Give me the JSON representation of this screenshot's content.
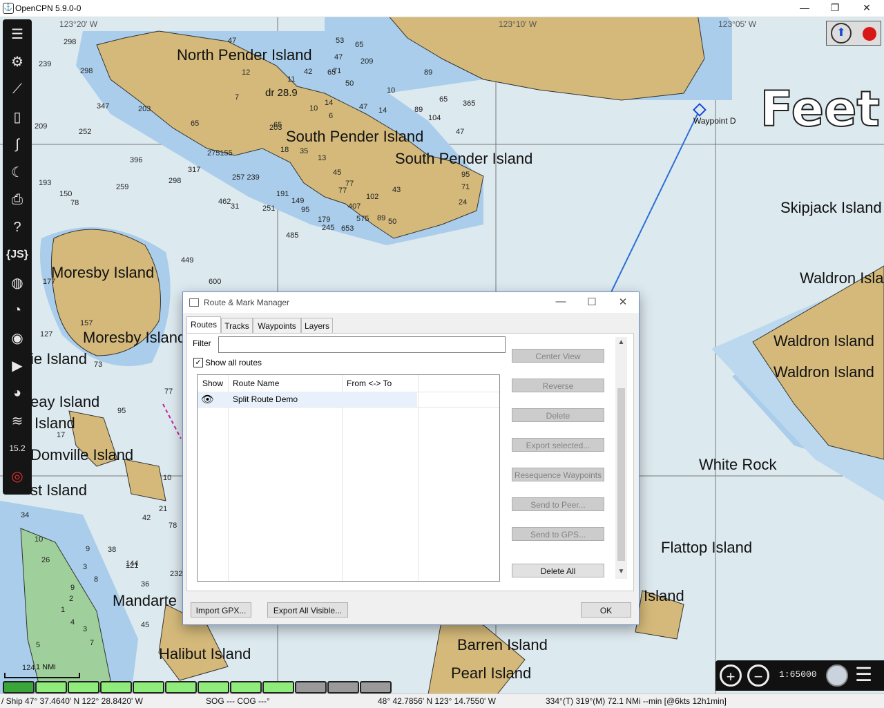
{
  "window": {
    "title": "OpenCPN 5.9.0-0",
    "minimize": "—",
    "maximize": "❐",
    "close": "✕"
  },
  "chart": {
    "units_overlay": "Feet",
    "labels": [
      {
        "id": "north-pender",
        "text": "North Pender Island"
      },
      {
        "id": "south-pender-1",
        "text": "South Pender Island"
      },
      {
        "id": "south-pender-2",
        "text": "South Pender Island"
      },
      {
        "id": "moresby-1",
        "text": "Moresby Island"
      },
      {
        "id": "moresby-2",
        "text": "Moresby Island"
      },
      {
        "id": "skipjack",
        "text": "Skipjack Island"
      },
      {
        "id": "waldron-top",
        "text": "Waldron Isla"
      },
      {
        "id": "waldron-1",
        "text": "Waldron Island"
      },
      {
        "id": "waldron-2",
        "text": "Waldron Island"
      },
      {
        "id": "white-rock",
        "text": "White Rock"
      },
      {
        "id": "flattop",
        "text": "Flattop Island"
      },
      {
        "id": "island-fragment",
        "text": "Island"
      },
      {
        "id": "barren",
        "text": "Barren Island"
      },
      {
        "id": "pearl",
        "text": "Pearl Island"
      },
      {
        "id": "halibut",
        "text": "Halibut Island"
      },
      {
        "id": "mandarte",
        "text": "Mandarte"
      },
      {
        "id": "domville",
        "text": "Domville Island"
      },
      {
        "id": "ie-island",
        "text": "ie Island"
      },
      {
        "id": "eay-island",
        "text": "eay Island"
      },
      {
        "id": "island-left",
        "text": "Island"
      },
      {
        "id": "st-island",
        "text": "st Island"
      },
      {
        "id": "waypoint-d",
        "text": "Waypoint D"
      },
      {
        "id": "dr",
        "text": "dr 28.9"
      }
    ],
    "lon_labels": [
      "123°20' W",
      "123°10' W",
      "123°05' W"
    ],
    "depths": [
      "298",
      "239",
      "298",
      "347",
      "203",
      "65",
      "252",
      "209",
      "396",
      "317",
      "275155",
      "257 239",
      "298",
      "193",
      "150",
      "259",
      "78",
      "462",
      "31",
      "251",
      "191",
      "149",
      "95",
      "179",
      "245",
      "653",
      "407",
      "575",
      "89",
      "50",
      "485",
      "449",
      "600",
      "177",
      "157",
      "127",
      "73",
      "95",
      "77",
      "17",
      "66",
      "34",
      "38",
      "121",
      "144",
      "232",
      "36",
      "45",
      "5",
      "124",
      "78",
      "21",
      "47",
      "53",
      "65",
      "209",
      "47",
      "65",
      "12",
      "11",
      "42",
      "71",
      "7",
      "14",
      "10",
      "6",
      "47",
      "14",
      "10",
      "65",
      "203",
      "18",
      "35",
      "13",
      "45",
      "77",
      "77",
      "102",
      "43",
      "95",
      "71",
      "24",
      "47",
      "89",
      "65",
      "365",
      "104",
      "89",
      "50",
      "10",
      "42",
      "9",
      "3",
      "8",
      "9",
      "2",
      "1",
      "4",
      "3",
      "7",
      "10",
      "26"
    ],
    "dock_value": "15.2"
  },
  "toolbar": [
    {
      "id": "menu",
      "icon": "hamburger-icon"
    },
    {
      "id": "settings",
      "icon": "gear-icon"
    },
    {
      "id": "route",
      "icon": "route-icon"
    },
    {
      "id": "route-manager",
      "icon": "document-icon"
    },
    {
      "id": "track",
      "icon": "track-icon"
    },
    {
      "id": "night-mode",
      "icon": "moon-star-icon"
    },
    {
      "id": "print",
      "icon": "printer-icon"
    },
    {
      "id": "help",
      "icon": "help-icon"
    },
    {
      "id": "js",
      "icon": "js-icon",
      "label": "{JS}"
    },
    {
      "id": "globe",
      "icon": "globe-search-icon"
    },
    {
      "id": "chart-download",
      "icon": "chart-icon"
    },
    {
      "id": "record",
      "icon": "record-icon"
    },
    {
      "id": "play",
      "icon": "play-icon"
    },
    {
      "id": "dashboard",
      "icon": "gauge-icon"
    },
    {
      "id": "tide",
      "icon": "tide-icon"
    },
    {
      "id": "wind",
      "icon": "wind-icon",
      "label": "15.2"
    },
    {
      "id": "mob",
      "icon": "lifebuoy-icon"
    }
  ],
  "scale_bar": {
    "label": "1 NMi"
  },
  "zoom": {
    "in": "+",
    "out": "−",
    "scale": "1:65000"
  },
  "statusbar": {
    "ship": "/ Ship 47° 37.4640' N   122° 28.8420' W",
    "sog": "SOG --- COG ---°",
    "cursor": "48° 42.7856' N   123° 14.7550' W",
    "bearing": "334°(T)  319°(M)  72.1 NMi --min [@6kts 12h1min]"
  },
  "dialog": {
    "title": "Route & Mark Manager",
    "min": "—",
    "max": "☐",
    "close": "✕",
    "tabs": [
      "Routes",
      "Tracks",
      "Waypoints",
      "Layers"
    ],
    "active_tab": "Routes",
    "filter_label": "Filter",
    "filter_value": "",
    "show_all_label": "Show all routes",
    "show_all_checked": true,
    "columns": [
      "Show",
      "Route Name",
      "From <-> To"
    ],
    "routes": [
      {
        "show": "visible",
        "name": "Split Route Demo",
        "from_to": ""
      }
    ],
    "side_buttons": [
      {
        "label": "Center View",
        "enabled": false
      },
      {
        "label": "Reverse",
        "enabled": false
      },
      {
        "label": "Delete",
        "enabled": false
      },
      {
        "label": "Export selected...",
        "enabled": false
      },
      {
        "label": "Resequence Waypoints",
        "enabled": false
      },
      {
        "label": "Send to Peer...",
        "enabled": false
      },
      {
        "label": "Send to GPS...",
        "enabled": false
      },
      {
        "label": "Delete All",
        "enabled": true
      }
    ],
    "import_gpx": "Import GPX...",
    "export_all": "Export All Visible...",
    "ok": "OK"
  }
}
